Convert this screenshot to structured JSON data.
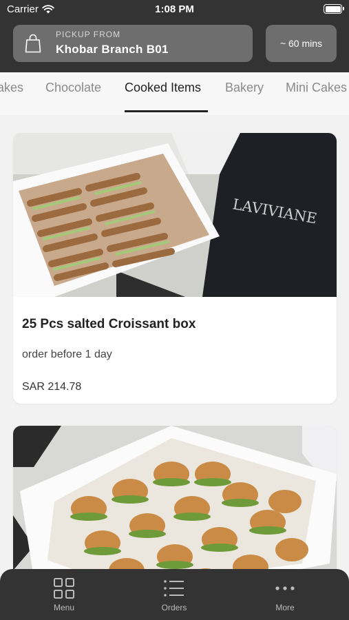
{
  "status_bar": {
    "carrier": "Carrier",
    "time": "1:08 PM"
  },
  "pickup": {
    "label": "PICKUP FROM",
    "branch": "Khobar Branch B01",
    "icon": "shopping-bag-icon"
  },
  "eta": {
    "label": "~ 60 mins"
  },
  "categories": {
    "items": [
      "akes",
      "Chocolate",
      "Cooked Items",
      "Bakery",
      "Mini Cakes"
    ],
    "selected": "Cooked Items"
  },
  "products": [
    {
      "title": "25 Pcs salted Croissant box",
      "note": "order before 1 day",
      "price": "SAR 214.78",
      "image": "croissant-box-photo",
      "apron_brand": "LAVIVIANE"
    },
    {
      "image": "burger-slider-box-photo"
    }
  ],
  "tab_bar": {
    "items": [
      {
        "label": "Menu",
        "icon": "grid-icon"
      },
      {
        "label": "Orders",
        "icon": "list-icon"
      },
      {
        "label": "More",
        "icon": "more-dots-icon"
      }
    ]
  },
  "colors": {
    "header_bg": "#333333",
    "pill_bg": "#6e6e6e",
    "page_bg": "#f2f2f2"
  }
}
